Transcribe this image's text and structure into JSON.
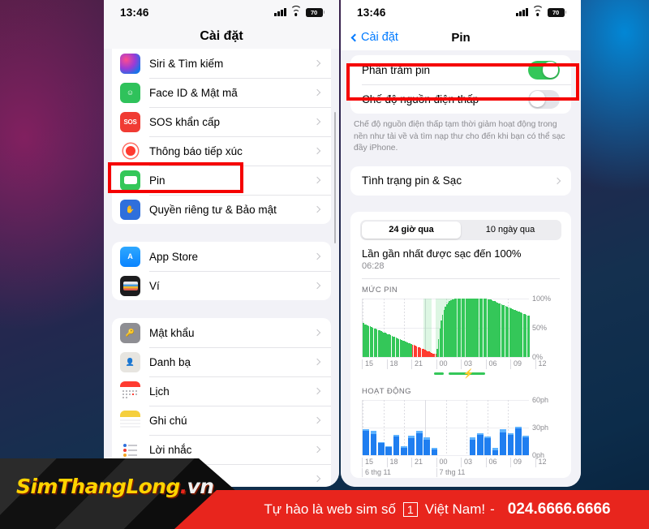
{
  "statusbar": {
    "time": "13:46",
    "battery_percent": "70"
  },
  "left_phone": {
    "nav_title": "Cài đặt",
    "groups": [
      {
        "items": [
          {
            "label": "Siri & Tìm kiếm",
            "icon": "siri-icon"
          },
          {
            "label": "Face ID & Mật mã",
            "icon": "faceid-icon"
          },
          {
            "label": "SOS khẩn cấp",
            "icon": "sos-icon",
            "icon_text": "SOS"
          },
          {
            "label": "Thông báo tiếp xúc",
            "icon": "exposure-notification-icon"
          },
          {
            "label": "Pin",
            "icon": "battery-icon",
            "highlighted": true
          },
          {
            "label": "Quyền riêng tư & Bảo mật",
            "icon": "privacy-hand-icon"
          }
        ]
      },
      {
        "items": [
          {
            "label": "App Store",
            "icon": "app-store-icon"
          },
          {
            "label": "Ví",
            "icon": "wallet-icon"
          }
        ]
      },
      {
        "items": [
          {
            "label": "Mật khẩu",
            "icon": "passwords-key-icon"
          },
          {
            "label": "Danh bạ",
            "icon": "contacts-icon"
          },
          {
            "label": "Lịch",
            "icon": "calendar-icon"
          },
          {
            "label": "Ghi chú",
            "icon": "notes-icon"
          },
          {
            "label": "Lời nhắc",
            "icon": "reminders-icon"
          }
        ]
      }
    ]
  },
  "right_phone": {
    "back_label": "Cài đặt",
    "nav_title": "Pin",
    "battery_percentage_row": {
      "label": "Phần trăm pin",
      "toggle": "on",
      "highlighted": true
    },
    "low_power_row": {
      "label": "Chế độ nguồn điện thấp",
      "toggle": "off"
    },
    "footnote": "Chế độ nguồn điện thấp tạm thời giảm hoạt động trong nền như tải về và tìm nạp thư cho đến khi bạn có thể sạc đầy iPhone.",
    "battery_health_row": {
      "label": "Tình trạng pin & Sạc"
    },
    "segmented": {
      "options": [
        "24 giờ qua",
        "10 ngày qua"
      ],
      "selected": "24 giờ qua"
    },
    "last_charge": {
      "title": "Lần gần nhất được sạc đến 100%",
      "time": "06:28"
    }
  },
  "chart_data": [
    {
      "type": "bar",
      "title": "MỨC PIN",
      "ylabel": "",
      "xlabel": "",
      "ylim": [
        0,
        100
      ],
      "ytick_labels": [
        "100%",
        "50%",
        "0%"
      ],
      "ytick_values": [
        100,
        50,
        0
      ],
      "xtick_labels": [
        "15",
        "18",
        "21",
        "00",
        "03",
        "06",
        "09",
        "12"
      ],
      "xtick_positions": [
        0,
        12.5,
        25,
        37.5,
        50,
        62.5,
        75,
        87.5
      ],
      "series": [
        {
          "name": "battery-level",
          "values": [
            58,
            56,
            55,
            54,
            53,
            52,
            51,
            50,
            49,
            48,
            47,
            46,
            45,
            44,
            43,
            42,
            41,
            40,
            39,
            38,
            37,
            36,
            35,
            34,
            33,
            32,
            31,
            30,
            29,
            28,
            27,
            26,
            25,
            24,
            23,
            22,
            21,
            20,
            19,
            18,
            17,
            16,
            15,
            14,
            13,
            12,
            11,
            10,
            9,
            8,
            7,
            6,
            5,
            6,
            14,
            30,
            48,
            62,
            72,
            80,
            86,
            90,
            93,
            95,
            97,
            98,
            99,
            100,
            100,
            100,
            100,
            100,
            100,
            100,
            100,
            100,
            100,
            100,
            100,
            100,
            100,
            100,
            100,
            100,
            100,
            100,
            100,
            100,
            100,
            100,
            100,
            99,
            99,
            98,
            97,
            96,
            95,
            94,
            93,
            92,
            91,
            90,
            89,
            88,
            87,
            86,
            85,
            84,
            83,
            82,
            81,
            80,
            79,
            78,
            77,
            76,
            75,
            74,
            73,
            72,
            71,
            70
          ]
        },
        {
          "name": "colors-note",
          "red_range_start_index": 36,
          "red_range_end_index": 53
        }
      ],
      "charging_periods": [
        {
          "start_pct": 36.5,
          "end_pct": 41.5,
          "label": "charging-band-1"
        },
        {
          "start_pct": 44.0,
          "end_pct": 62.5,
          "label": "charging-band-2"
        }
      ]
    },
    {
      "type": "bar",
      "title": "HOẠT ĐỘNG",
      "ylabel": "",
      "xlabel": "",
      "ylim": [
        0,
        60
      ],
      "ytick_labels": [
        "60ph",
        "30ph",
        "0ph"
      ],
      "ytick_values": [
        60,
        30,
        0
      ],
      "xtick_labels": [
        "15",
        "18",
        "21",
        "00",
        "03",
        "06",
        "09",
        "12"
      ],
      "xtick_positions": [
        0,
        12.5,
        25,
        37.5,
        50,
        62.5,
        75,
        87.5
      ],
      "date_labels": [
        "6 thg 11",
        "7 thg 11"
      ],
      "date_positions": [
        0,
        37.5
      ],
      "series": [
        {
          "name": "screen-on",
          "values": [
            26,
            23,
            13,
            9,
            20,
            8,
            18,
            24,
            17,
            6,
            0,
            0,
            0,
            0,
            17,
            22,
            18,
            5,
            25,
            22,
            29,
            19
          ]
        },
        {
          "name": "screen-off-cap",
          "values": [
            2,
            3,
            1,
            1,
            2,
            2,
            3,
            2,
            2,
            2,
            0,
            0,
            0,
            0,
            2,
            2,
            2,
            3,
            3,
            2,
            2,
            2
          ]
        }
      ]
    }
  ],
  "banner": {
    "logo_main": "SimThangLong",
    "logo_dot": ".",
    "logo_tld": "vn",
    "text_before": "Tự hào là web sim số",
    "number_box": "1",
    "text_after": "Việt Nam!",
    "dash": "-",
    "phone": "024.6666.6666"
  },
  "colors": {
    "ios_green": "#34C759",
    "ios_blue": "#007AFF",
    "ios_red": "#FF3B30",
    "activity_blue": "#1F7EF0",
    "highlight_red": "#F50000",
    "banner_red": "#E8251D",
    "logo_yellow": "#FFD400"
  }
}
